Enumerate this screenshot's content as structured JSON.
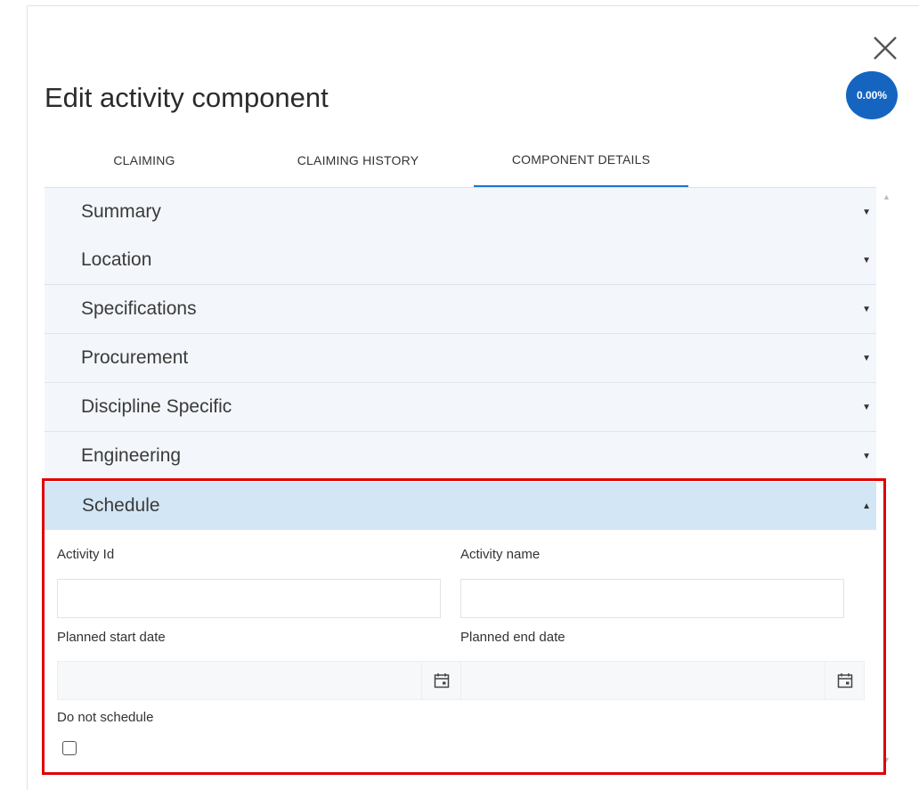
{
  "dialog": {
    "title": "Edit activity component",
    "progress": "0.00%",
    "close_icon": "close-icon"
  },
  "tabs": [
    {
      "label": "CLAIMING",
      "active": false
    },
    {
      "label": "CLAIMING HISTORY",
      "active": false
    },
    {
      "label": "COMPONENT DETAILS",
      "active": true
    }
  ],
  "accordion": [
    {
      "label": "Summary",
      "expanded": false
    },
    {
      "label": "Location",
      "expanded": false
    },
    {
      "label": "Specifications",
      "expanded": false
    },
    {
      "label": "Procurement",
      "expanded": false
    },
    {
      "label": "Discipline Specific",
      "expanded": false
    },
    {
      "label": "Engineering",
      "expanded": false
    },
    {
      "label": "Schedule",
      "expanded": true
    }
  ],
  "schedule": {
    "activity_id": {
      "label": "Activity Id",
      "value": ""
    },
    "activity_name": {
      "label": "Activity name",
      "value": ""
    },
    "planned_start": {
      "label": "Planned start date",
      "value": ""
    },
    "planned_end": {
      "label": "Planned end date",
      "value": ""
    },
    "do_not_schedule": {
      "label": "Do not schedule",
      "checked": false
    }
  },
  "colors": {
    "accent": "#1976d2",
    "badge": "#1565c0",
    "highlight": "#e00000",
    "expanded_header": "#d3e6f5"
  }
}
